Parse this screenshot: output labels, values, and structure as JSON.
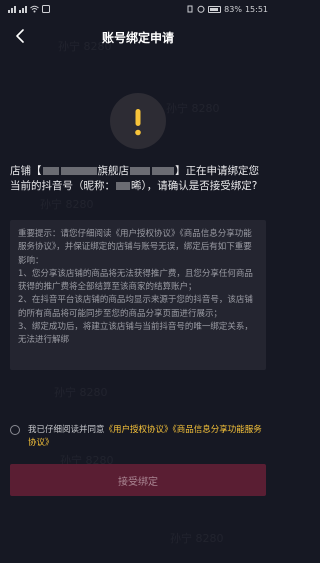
{
  "status_bar": {
    "signal": "|||",
    "battery_percent": "83%",
    "time": "15:51"
  },
  "nav": {
    "back_icon": "chevron-left-icon",
    "title": "账号绑定申请"
  },
  "warning_icon": "exclamation-icon",
  "store": {
    "line_start": "店铺【",
    "mid_text": "旗舰店",
    "after_name": "】正在申请绑定您当前的抖音号（昵称：",
    "nickname_tail": "晞",
    "line_end": "），请确认是否接受绑定?"
  },
  "notice": {
    "intro": "重要提示：请您仔细阅读《用户授权协议》《商品信息分享功能服务协议》，并保证绑定的店铺与账号无误，绑定后有如下重要影响：",
    "item1": "1、您分享该店铺的商品将无法获得推广费，且您分享任何商品获得的推广费将全部结算至该商家的结算账户；",
    "item2": "2、在抖音平台该店铺的商品均显示来源于您的抖音号，该店铺的所有商品将可能同步至您的商品分享页面进行展示；",
    "item3": "3、绑定成功后，将建立该店铺与当前抖音号的唯一绑定关系，无法进行解绑"
  },
  "agreement": {
    "prefix": "我已仔细阅读并同意",
    "link1": "《用户授权协议》",
    "link2": "《商品信息分享功能服务协议》"
  },
  "button": {
    "label": "接受绑定"
  },
  "watermark": {
    "text": "孙宁 8280"
  },
  "colors": {
    "background": "#161823",
    "notice_bg": "#242530",
    "warning_yellow": "#f8c43a",
    "link_yellow": "#f8c43a",
    "button_bg": "#5a1e33"
  }
}
